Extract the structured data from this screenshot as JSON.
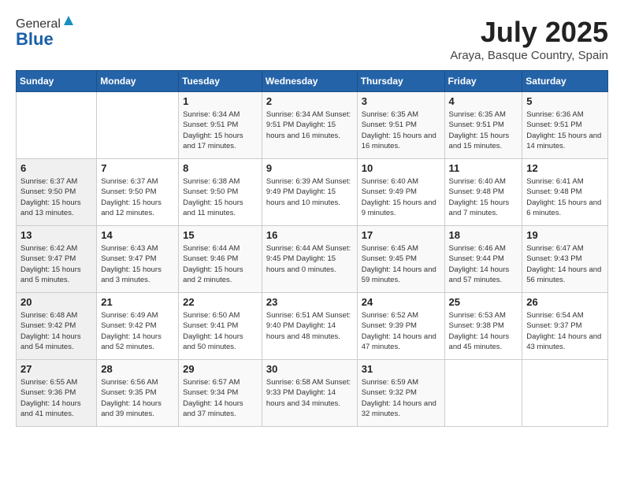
{
  "header": {
    "logo_general": "General",
    "logo_blue": "Blue",
    "month_title": "July 2025",
    "location": "Araya, Basque Country, Spain"
  },
  "weekdays": [
    "Sunday",
    "Monday",
    "Tuesday",
    "Wednesday",
    "Thursday",
    "Friday",
    "Saturday"
  ],
  "weeks": [
    [
      {
        "day": "",
        "info": ""
      },
      {
        "day": "",
        "info": ""
      },
      {
        "day": "1",
        "info": "Sunrise: 6:34 AM\nSunset: 9:51 PM\nDaylight: 15 hours\nand 17 minutes."
      },
      {
        "day": "2",
        "info": "Sunrise: 6:34 AM\nSunset: 9:51 PM\nDaylight: 15 hours\nand 16 minutes."
      },
      {
        "day": "3",
        "info": "Sunrise: 6:35 AM\nSunset: 9:51 PM\nDaylight: 15 hours\nand 16 minutes."
      },
      {
        "day": "4",
        "info": "Sunrise: 6:35 AM\nSunset: 9:51 PM\nDaylight: 15 hours\nand 15 minutes."
      },
      {
        "day": "5",
        "info": "Sunrise: 6:36 AM\nSunset: 9:51 PM\nDaylight: 15 hours\nand 14 minutes."
      }
    ],
    [
      {
        "day": "6",
        "info": "Sunrise: 6:37 AM\nSunset: 9:50 PM\nDaylight: 15 hours\nand 13 minutes."
      },
      {
        "day": "7",
        "info": "Sunrise: 6:37 AM\nSunset: 9:50 PM\nDaylight: 15 hours\nand 12 minutes."
      },
      {
        "day": "8",
        "info": "Sunrise: 6:38 AM\nSunset: 9:50 PM\nDaylight: 15 hours\nand 11 minutes."
      },
      {
        "day": "9",
        "info": "Sunrise: 6:39 AM\nSunset: 9:49 PM\nDaylight: 15 hours\nand 10 minutes."
      },
      {
        "day": "10",
        "info": "Sunrise: 6:40 AM\nSunset: 9:49 PM\nDaylight: 15 hours\nand 9 minutes."
      },
      {
        "day": "11",
        "info": "Sunrise: 6:40 AM\nSunset: 9:48 PM\nDaylight: 15 hours\nand 7 minutes."
      },
      {
        "day": "12",
        "info": "Sunrise: 6:41 AM\nSunset: 9:48 PM\nDaylight: 15 hours\nand 6 minutes."
      }
    ],
    [
      {
        "day": "13",
        "info": "Sunrise: 6:42 AM\nSunset: 9:47 PM\nDaylight: 15 hours\nand 5 minutes."
      },
      {
        "day": "14",
        "info": "Sunrise: 6:43 AM\nSunset: 9:47 PM\nDaylight: 15 hours\nand 3 minutes."
      },
      {
        "day": "15",
        "info": "Sunrise: 6:44 AM\nSunset: 9:46 PM\nDaylight: 15 hours\nand 2 minutes."
      },
      {
        "day": "16",
        "info": "Sunrise: 6:44 AM\nSunset: 9:45 PM\nDaylight: 15 hours\nand 0 minutes."
      },
      {
        "day": "17",
        "info": "Sunrise: 6:45 AM\nSunset: 9:45 PM\nDaylight: 14 hours\nand 59 minutes."
      },
      {
        "day": "18",
        "info": "Sunrise: 6:46 AM\nSunset: 9:44 PM\nDaylight: 14 hours\nand 57 minutes."
      },
      {
        "day": "19",
        "info": "Sunrise: 6:47 AM\nSunset: 9:43 PM\nDaylight: 14 hours\nand 56 minutes."
      }
    ],
    [
      {
        "day": "20",
        "info": "Sunrise: 6:48 AM\nSunset: 9:42 PM\nDaylight: 14 hours\nand 54 minutes."
      },
      {
        "day": "21",
        "info": "Sunrise: 6:49 AM\nSunset: 9:42 PM\nDaylight: 14 hours\nand 52 minutes."
      },
      {
        "day": "22",
        "info": "Sunrise: 6:50 AM\nSunset: 9:41 PM\nDaylight: 14 hours\nand 50 minutes."
      },
      {
        "day": "23",
        "info": "Sunrise: 6:51 AM\nSunset: 9:40 PM\nDaylight: 14 hours\nand 48 minutes."
      },
      {
        "day": "24",
        "info": "Sunrise: 6:52 AM\nSunset: 9:39 PM\nDaylight: 14 hours\nand 47 minutes."
      },
      {
        "day": "25",
        "info": "Sunrise: 6:53 AM\nSunset: 9:38 PM\nDaylight: 14 hours\nand 45 minutes."
      },
      {
        "day": "26",
        "info": "Sunrise: 6:54 AM\nSunset: 9:37 PM\nDaylight: 14 hours\nand 43 minutes."
      }
    ],
    [
      {
        "day": "27",
        "info": "Sunrise: 6:55 AM\nSunset: 9:36 PM\nDaylight: 14 hours\nand 41 minutes."
      },
      {
        "day": "28",
        "info": "Sunrise: 6:56 AM\nSunset: 9:35 PM\nDaylight: 14 hours\nand 39 minutes."
      },
      {
        "day": "29",
        "info": "Sunrise: 6:57 AM\nSunset: 9:34 PM\nDaylight: 14 hours\nand 37 minutes."
      },
      {
        "day": "30",
        "info": "Sunrise: 6:58 AM\nSunset: 9:33 PM\nDaylight: 14 hours\nand 34 minutes."
      },
      {
        "day": "31",
        "info": "Sunrise: 6:59 AM\nSunset: 9:32 PM\nDaylight: 14 hours\nand 32 minutes."
      },
      {
        "day": "",
        "info": ""
      },
      {
        "day": "",
        "info": ""
      }
    ]
  ]
}
